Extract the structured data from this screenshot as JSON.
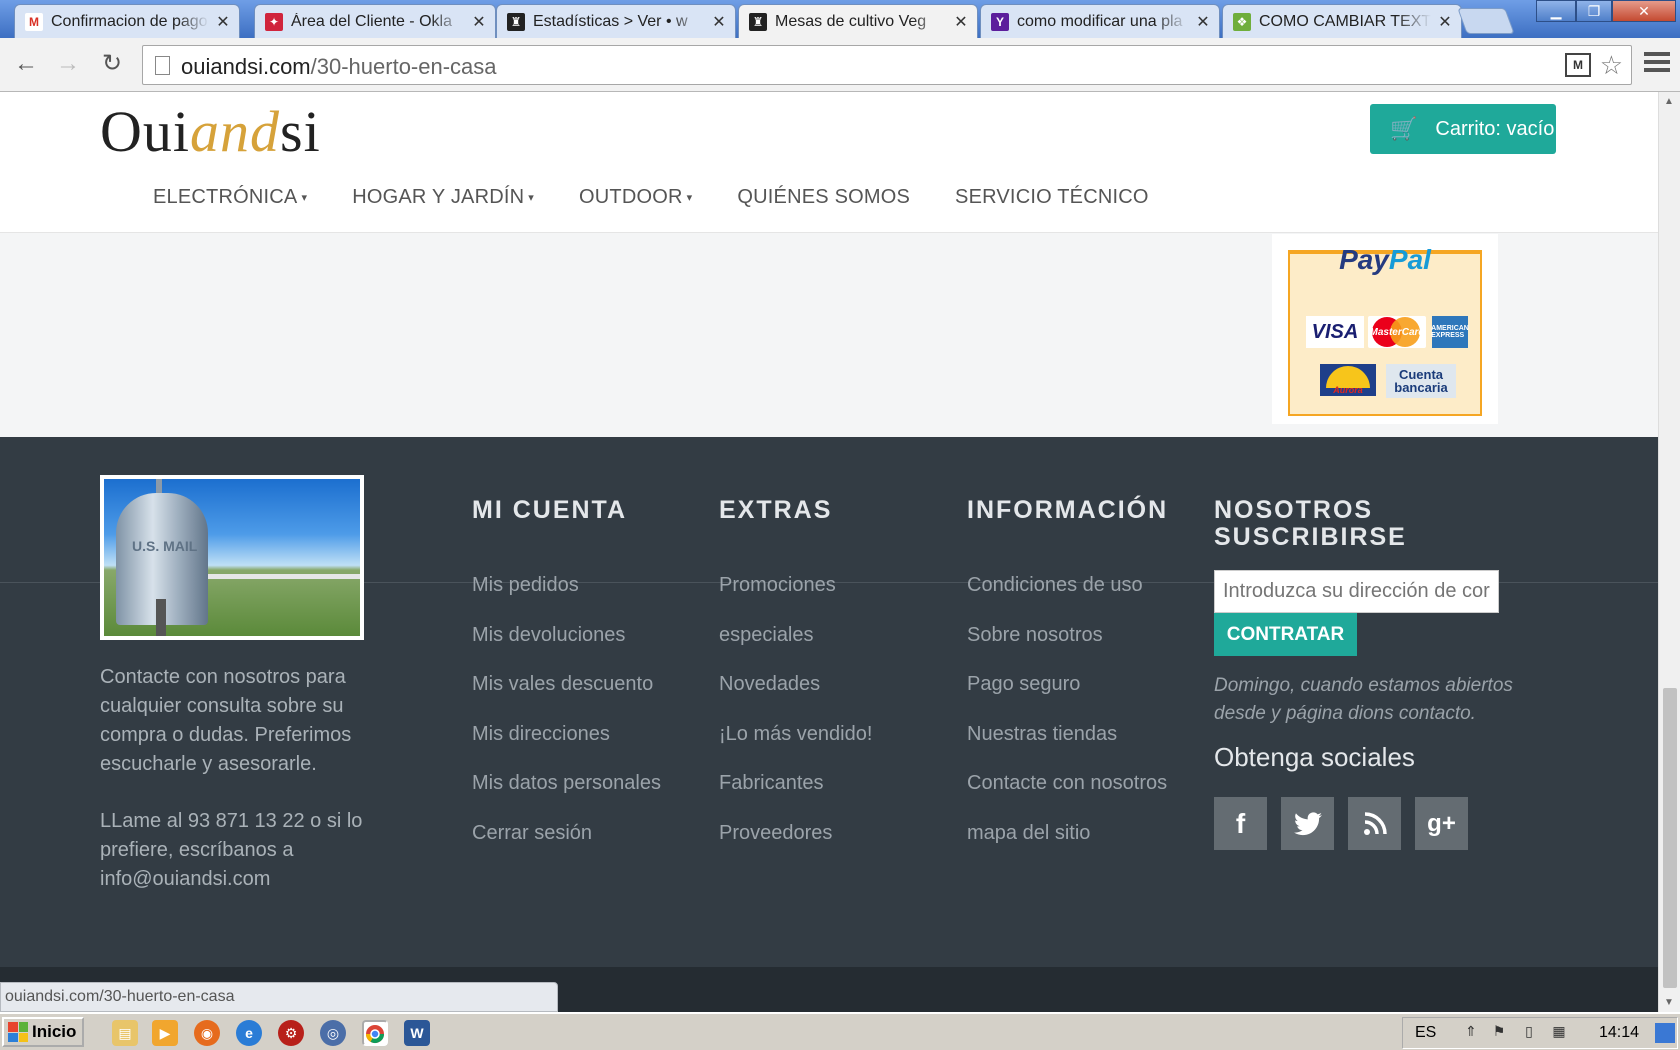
{
  "browser": {
    "tabs": [
      {
        "title": "Confirmacion de pago",
        "fav_color": "#ffffff",
        "fav_glyph": "M"
      },
      {
        "title": "Área del Cliente - Okla",
        "fav_color": "#d0243c",
        "fav_glyph": "✦"
      },
      {
        "title": "Estadísticas > Ver • w",
        "fav_color": "#222222",
        "fav_glyph": "♜"
      },
      {
        "title": "Mesas de cultivo Veg",
        "fav_color": "#222222",
        "fav_glyph": "♜"
      },
      {
        "title": "como modificar una pla",
        "fav_color": "#5c1e9c",
        "fav_glyph": "Y"
      },
      {
        "title": "COMO CAMBIAR TEXT",
        "fav_color": "#6fae3c",
        "fav_glyph": "❖"
      }
    ],
    "tab_close": "✕",
    "window_buttons": {
      "minimize": "▁",
      "restore": "❐",
      "close": "✕"
    },
    "nav": {
      "back": "←",
      "forward": "→",
      "reload": "↻"
    },
    "url_domain": "ouiandsi.com",
    "url_path": "/30-huerto-en-casa",
    "ext_label": "M",
    "star": "☆",
    "status_url": "ouiandsi.com/30-huerto-en-casa"
  },
  "header": {
    "logo_part1": "Oui",
    "logo_part2": "and",
    "logo_part3": "si",
    "cart_label": "Carrito: vacío",
    "nav": [
      {
        "label": "ELECTRÓNICA",
        "dropdown": true
      },
      {
        "label": "HOGAR Y JARDÍN",
        "dropdown": true
      },
      {
        "label": "OUTDOOR",
        "dropdown": true
      },
      {
        "label": "QUIÉNES SOMOS",
        "dropdown": false
      },
      {
        "label": "SERVICIO TÉCNICO",
        "dropdown": false
      }
    ],
    "caret": "▾"
  },
  "payments": {
    "paypal_p1": "Pay",
    "paypal_p2": "Pal",
    "visa": "VISA",
    "mastercard": "MasterCard",
    "amex": "AMERICAN EXPRESS",
    "aurora": "Aurora",
    "cuenta_line1": "Cuenta",
    "cuenta_line2": "bancaria"
  },
  "footer": {
    "mailbox_text": "U.S. MAIL",
    "contact": "Contacte con nosotros para cualquier consulta sobre su compra o dudas. Preferimos escucharle y asesorarle.",
    "phone": "LLame al 93 871 13 22 o si lo prefiere, escríbanos a info@ouiandsi.com",
    "columns": {
      "cuenta": {
        "title": "MI CUENTA",
        "items": [
          "Mis pedidos",
          "Mis devoluciones",
          "Mis vales descuento",
          "Mis direcciones",
          "Mis datos personales",
          "Cerrar sesión"
        ]
      },
      "extras": {
        "title": "EXTRAS",
        "items": [
          "Promociones",
          "especiales",
          "Novedades",
          "¡Lo más vendido!",
          "Fabricantes",
          "Proveedores"
        ]
      },
      "info": {
        "title": "INFORMACIÓN",
        "items": [
          "Condiciones de uso",
          "Sobre nosotros",
          "Pago seguro",
          "Nuestras tiendas",
          "Contacte con nosotros",
          "mapa del sitio"
        ]
      }
    },
    "newsletter": {
      "title_line1": "NOSOTROS",
      "title_line2": "SUSCRIBIRSE",
      "placeholder": "Introduzca su dirección de correo",
      "button": "CONTRATAR",
      "note": "Domingo, cuando estamos abiertos desde y página dions contacto."
    },
    "social_title": "Obtenga sociales",
    "social": [
      {
        "name": "facebook-icon",
        "glyph": "f"
      },
      {
        "name": "twitter-icon",
        "glyph": "🐦"
      },
      {
        "name": "rss-icon",
        "glyph": "◔"
      },
      {
        "name": "google-plus-icon",
        "glyph": "g+"
      }
    ]
  },
  "taskbar": {
    "start": "Inicio",
    "lang": "ES",
    "clock": "14:14"
  },
  "colors": {
    "accent": "#1fa99a",
    "footer_bg": "#333c44",
    "logo_gold": "#d6a23a"
  }
}
